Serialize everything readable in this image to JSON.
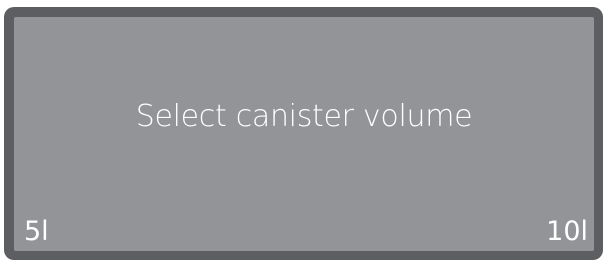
{
  "display": {
    "prompt": "Select canister volume",
    "left_option": "5l",
    "right_option": "10l"
  },
  "colors": {
    "frame": "#5c5e61",
    "screen": "#929497",
    "text": "#ffffff"
  }
}
